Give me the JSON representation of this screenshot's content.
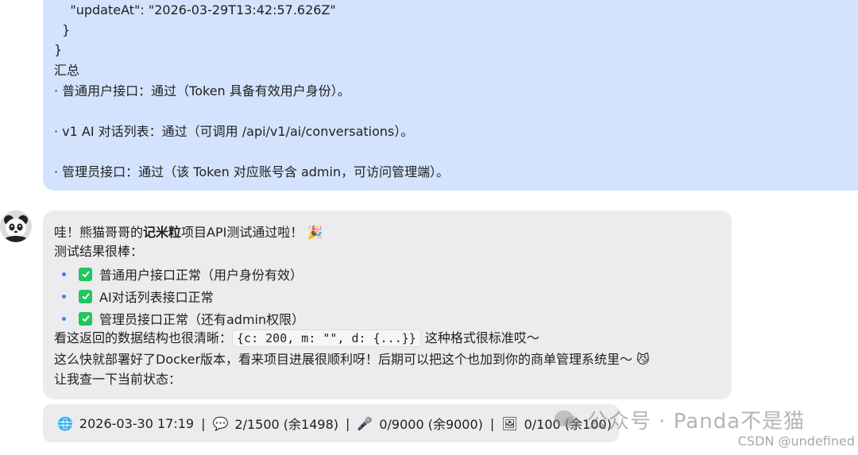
{
  "user_message": {
    "json_tail": [
      "    \"updateAt\": \"2026-03-29T13:42:57.626Z\"",
      "  }",
      "}"
    ],
    "summary_heading": "汇总",
    "items": [
      "· 普通用户接口：通过（Token 具备有效用户身份）。",
      "· v1 AI 对话列表：通过（可调用 /api/v1/ai/conversations）。",
      "· 管理员接口：通过（该 Token 对应账号含 admin，可访问管理端）。"
    ]
  },
  "assistant_message": {
    "line1_pre": "哇！熊猫哥哥的",
    "line1_bold": "记米粒",
    "line1_post": "项目API测试通过啦！",
    "line1_emoji": "🎉",
    "line2": "测试结果很棒：",
    "checks": [
      "普通用户接口正常（用户身份有效）",
      "AI对话列表接口正常",
      "管理员接口正常（还有admin权限）"
    ],
    "line_struct_pre": "看这返回的数据结构也很清晰：",
    "line_struct_code": "{c: 200, m: \"\", d: {...}}",
    "line_struct_post": "这种格式很标准哎～",
    "line_docker": "这么快就部署好了Docker版本，看来项目进展很顺利呀！后期可以把这个也加到你的商单管理系统里～",
    "line_docker_emoji": "😼",
    "line_last": "让我查一下当前状态："
  },
  "status_bar": {
    "globe_icon": "🌐",
    "datetime": "2026-03-30 17:19",
    "chat_icon": "💬",
    "messages": "2/1500 (余1498)",
    "mic_icon": "🎤",
    "voice": "0/9000 (余9000)",
    "image_icon": "🖼",
    "images": "0/100 (余100)",
    "separator": "|"
  },
  "watermark": {
    "text": "公众号 · Panda不是猫",
    "csdn": "CSDN @undefined"
  },
  "colors": {
    "user_bubble": "#d3e3fd",
    "assistant_bubble": "#ececef",
    "check_green": "#22c55e",
    "bullet_blue": "#3b82f6"
  }
}
